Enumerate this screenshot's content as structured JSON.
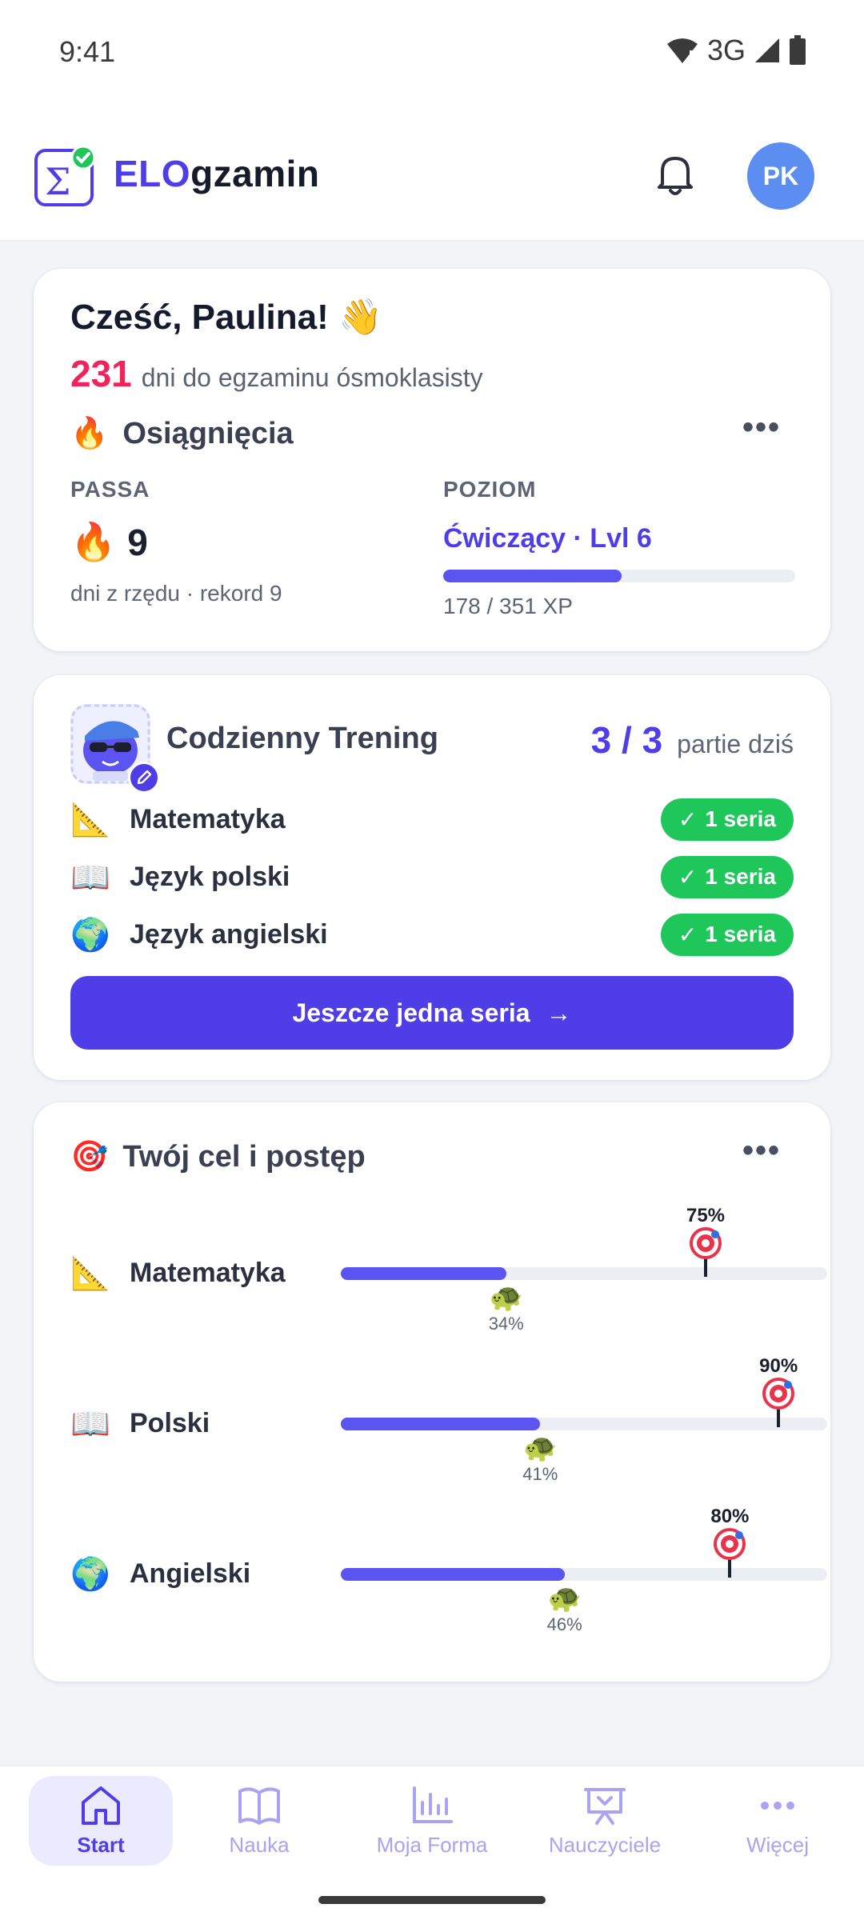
{
  "status_bar": {
    "time": "9:41",
    "network": "3G"
  },
  "app": {
    "brand_part1": "ELO",
    "brand_part2": "gzamin",
    "avatar_initials": "PK",
    "accent_color": "#4f3ee8"
  },
  "greeting_card": {
    "greeting": "Cześć, Paulina! 👋",
    "days_number": "231",
    "days_text": "dni do egzaminu ósmoklasisty",
    "section_title": "Osiągnięcia",
    "section_icon": "🔥",
    "streak_label": "PASSA",
    "streak_value": "9",
    "streak_icon": "🔥",
    "streak_sub": "dni z rzędu · rekord 9",
    "level_label": "POZIOM",
    "level_value": "Ćwiczący · Lvl 6",
    "level_progress": 0.507,
    "level_xp": "178 / 351 XP"
  },
  "training_card": {
    "title": "Codzienny Trening",
    "count": "3 / 3",
    "count_suffix": "partie dziś",
    "subjects": [
      {
        "icon": "📐",
        "name": "Matematyka",
        "badge": "1 seria"
      },
      {
        "icon": "📖",
        "name": "Język polski",
        "badge": "1 seria"
      },
      {
        "icon": "🌍",
        "name": "Język angielski",
        "badge": "1 seria"
      }
    ],
    "cta_label": "Jeszcze jedna seria"
  },
  "goal_card": {
    "title": "Twój cel i postęp",
    "icon": "🎯",
    "rows": [
      {
        "icon": "📐",
        "name": "Matematyka",
        "target_label": "75%",
        "target": 0.75,
        "progress_label": "34%",
        "progress": 0.34
      },
      {
        "icon": "📖",
        "name": "Polski",
        "target_label": "90%",
        "target": 0.9,
        "progress_label": "41%",
        "progress": 0.41
      },
      {
        "icon": "🌍",
        "name": "Angielski",
        "target_label": "80%",
        "target": 0.8,
        "progress_label": "46%",
        "progress": 0.46
      }
    ]
  },
  "bottom_nav": {
    "items": [
      {
        "label": "Start",
        "icon": "home-icon",
        "active": true
      },
      {
        "label": "Nauka",
        "icon": "book-icon",
        "active": false
      },
      {
        "label": "Moja Forma",
        "icon": "chart-icon",
        "active": false
      },
      {
        "label": "Nauczyciele",
        "icon": "presentation-icon",
        "active": false
      },
      {
        "label": "Więcej",
        "icon": "more-icon",
        "active": false
      }
    ]
  }
}
